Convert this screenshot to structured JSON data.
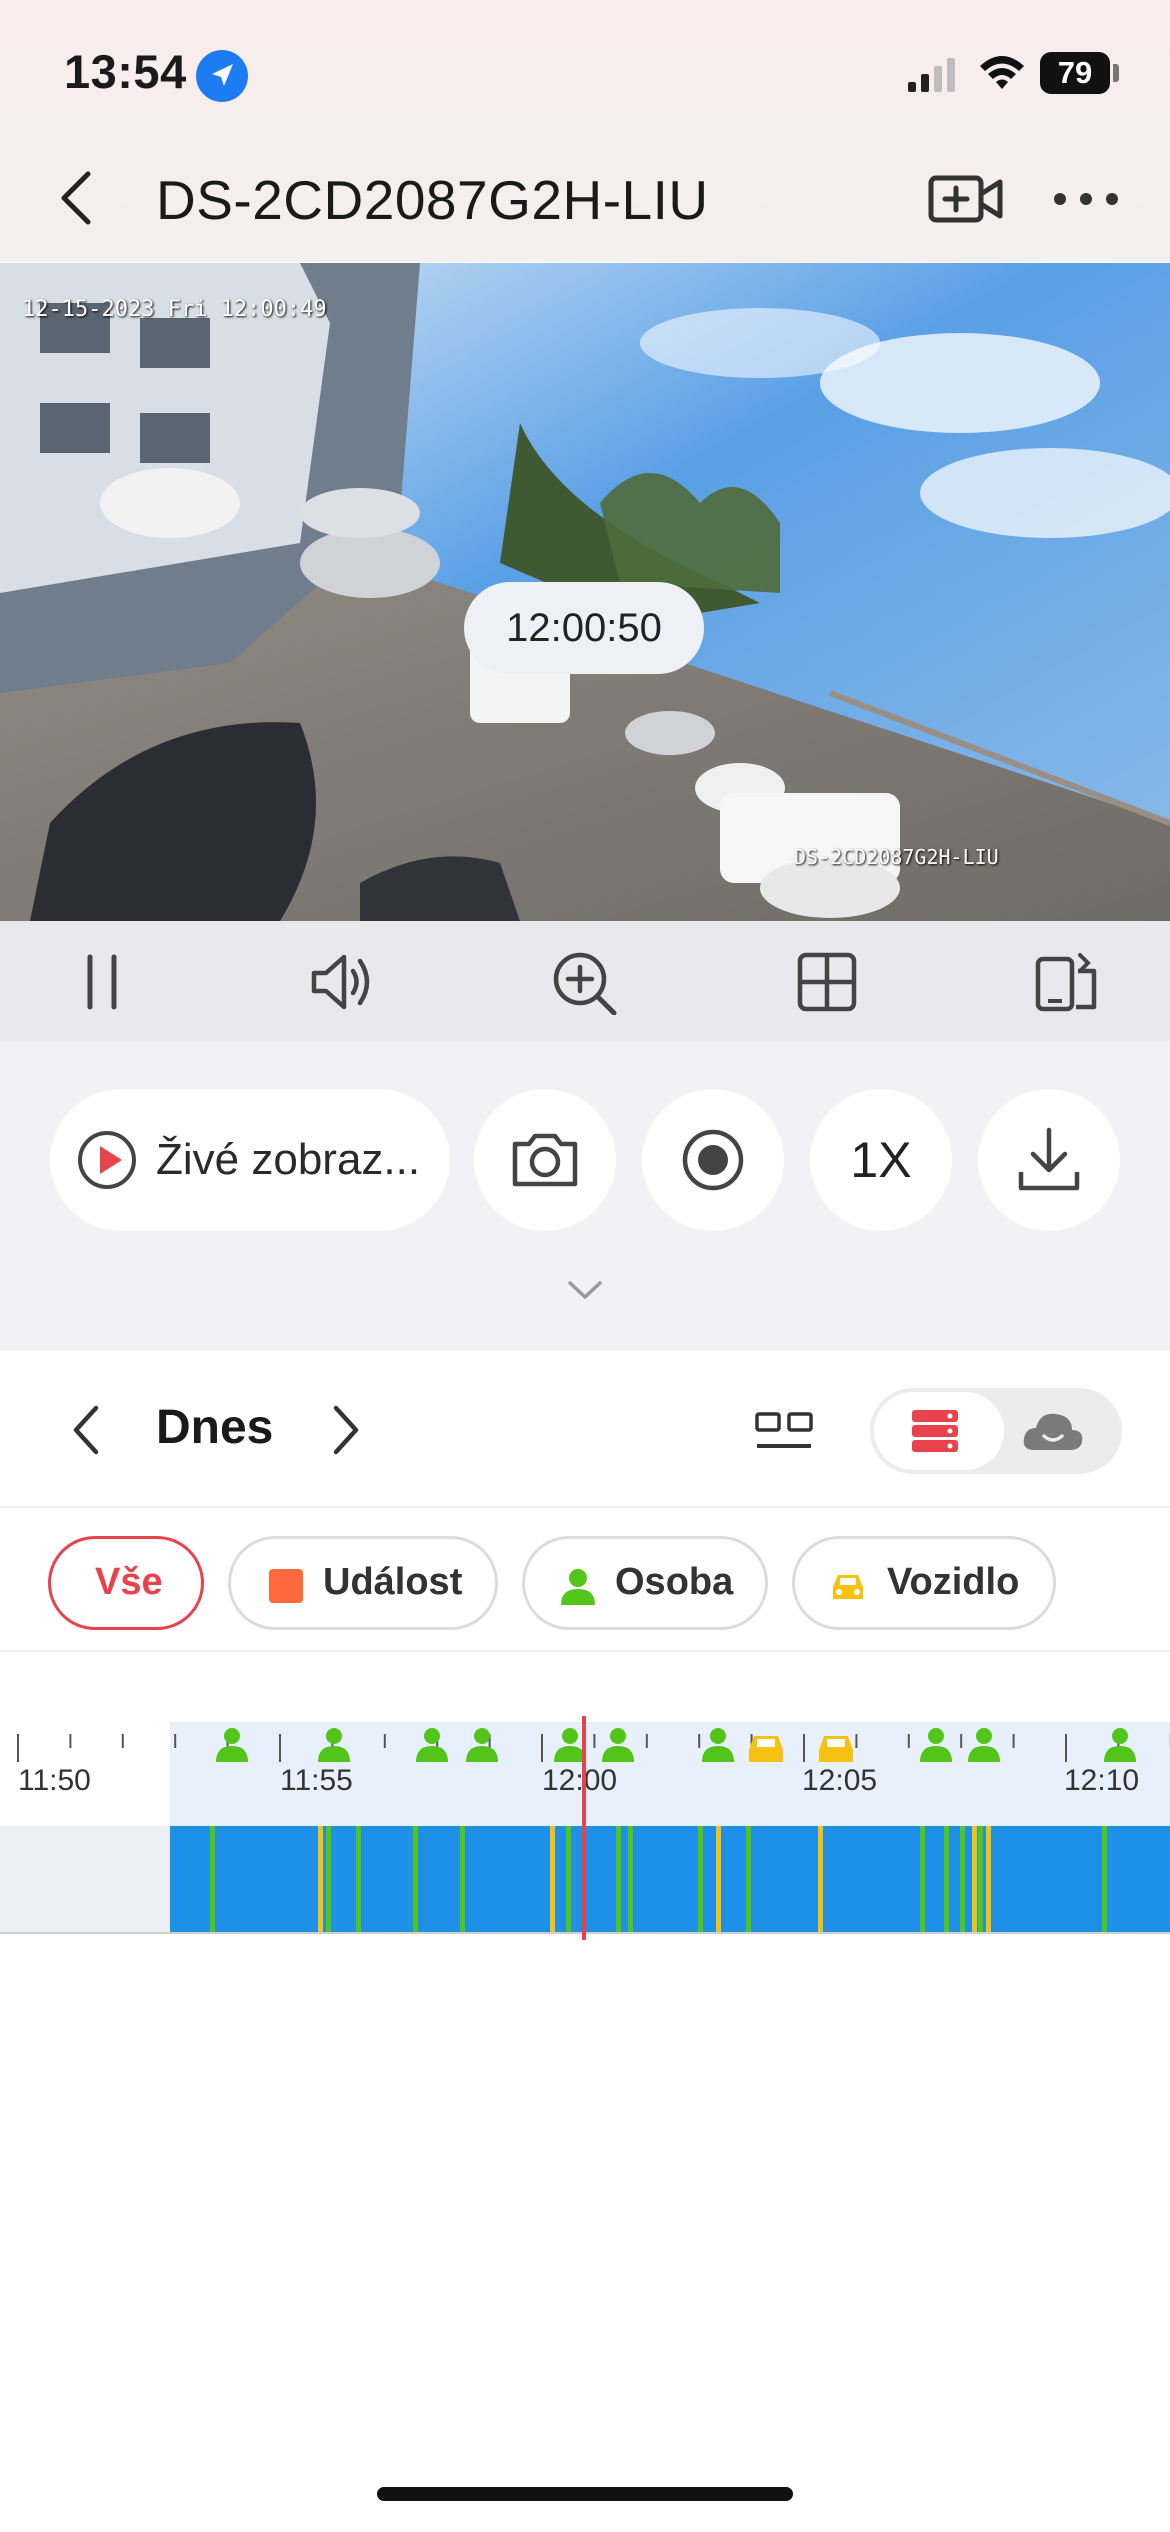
{
  "status_bar": {
    "time": "13:54",
    "battery": "79"
  },
  "nav": {
    "title": "DS-2CD2087G2H-LIU"
  },
  "video": {
    "timestamp_overlay": "12-15-2023 Fri 12:00:49",
    "camera_overlay": "DS-2CD2087G2H-LIU"
  },
  "controls": {
    "live_label": "Živé zobraz...",
    "speed_label": "1X"
  },
  "date_nav": {
    "label": "Dnes"
  },
  "filters": {
    "all": "Vše",
    "event": "Událost",
    "person": "Osoba",
    "vehicle": "Vozidlo"
  },
  "timeline": {
    "labels": [
      "11:50",
      "11:55",
      "12:00",
      "12:05",
      "12:10"
    ],
    "current_time": "12:00:50"
  },
  "colors": {
    "accent": "#e8434c",
    "recording": "#1d90e8",
    "person": "#52c41a",
    "vehicle": "#f5c211",
    "event": "#ff6a3d"
  }
}
